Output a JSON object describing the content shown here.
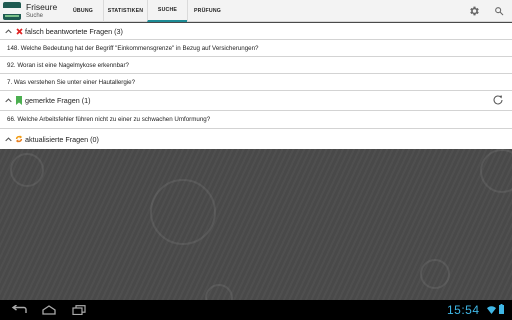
{
  "app": {
    "title": "Friseure",
    "subtitle": "Suche"
  },
  "tabs": [
    {
      "label": "ÜBUNG"
    },
    {
      "label": "STATISTIKEN"
    },
    {
      "label": "SUCHE"
    },
    {
      "label": "PRÜFUNG"
    }
  ],
  "active_tab": "SUCHE",
  "sections": {
    "wrong": {
      "title": "falsch beantwortete Fragen (3)",
      "items": [
        "148. Welche Bedeutung hat der Begriff \"Einkommensgrenze\" in Bezug auf Versicherungen?",
        "92. Woran ist eine Nagelmykose erkennbar?",
        "7. Was verstehen Sie unter einer Hautallergie?"
      ]
    },
    "marked": {
      "title": "gemerkte Fragen (1)",
      "items": [
        "66. Welche Arbeitsfehler führen nicht zu einer zu schwachen Umformung?"
      ]
    },
    "updated": {
      "title": "aktualisierte Fragen (0)"
    }
  },
  "status_bar": {
    "time": "15:54"
  },
  "colors": {
    "accent": "#1d8b95",
    "clock": "#3fb7e6",
    "wrong_icon": "#e02424",
    "bookmark_icon": "#4caf50",
    "update_icon": "#f39c12"
  }
}
